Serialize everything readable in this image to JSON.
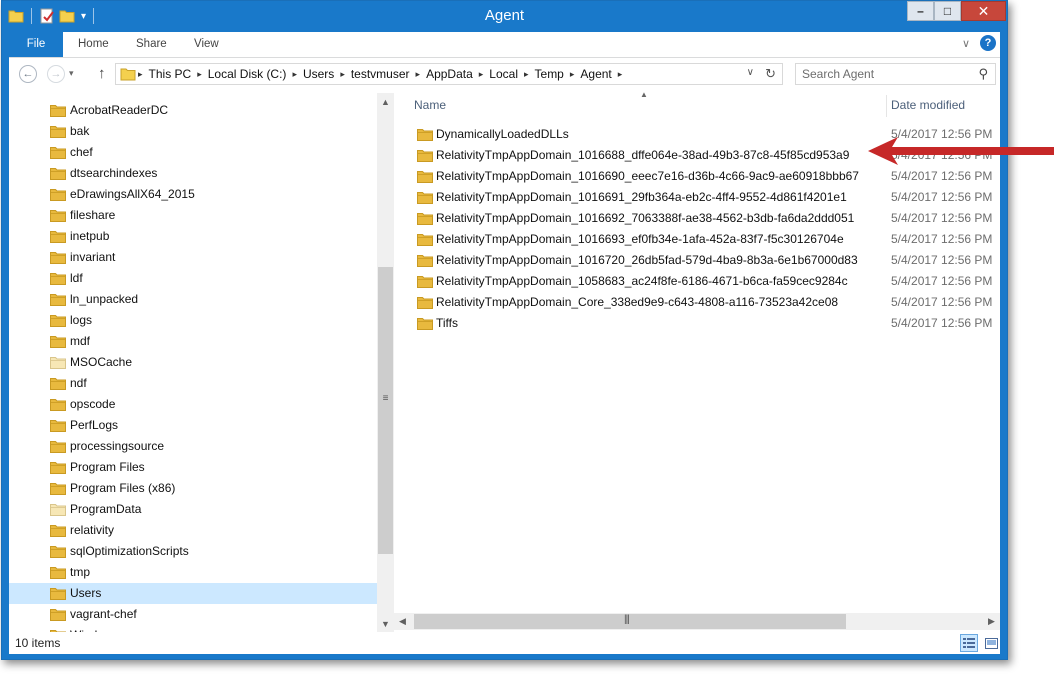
{
  "window": {
    "title": "Agent"
  },
  "ribbon": {
    "tabs": [
      "File",
      "Home",
      "Share",
      "View"
    ]
  },
  "address": {
    "crumbs": [
      "This PC",
      "Local Disk (C:)",
      "Users",
      "testvmuser",
      "AppData",
      "Local",
      "Temp",
      "Agent"
    ]
  },
  "search": {
    "placeholder": "Search Agent"
  },
  "columns": {
    "name": "Name",
    "date": "Date modified"
  },
  "tree": {
    "items": [
      "AcrobatReaderDC",
      "bak",
      "chef",
      "dtsearchindexes",
      "eDrawingsAllX64_2015",
      "fileshare",
      "inetpub",
      "invariant",
      "ldf",
      "ln_unpacked",
      "logs",
      "mdf",
      "MSOCache",
      "ndf",
      "opscode",
      "PerfLogs",
      "processingsource",
      "Program Files",
      "Program Files (x86)",
      "ProgramData",
      "relativity",
      "sqlOptimizationScripts",
      "tmp",
      "Users",
      "vagrant-chef",
      "Windows"
    ],
    "selected": "Users"
  },
  "files": [
    {
      "name": "DynamicallyLoadedDLLs",
      "date": "5/4/2017 12:56 PM"
    },
    {
      "name": "RelativityTmpAppDomain_1016688_dffe064e-38ad-49b3-87c8-45f85cd953a9",
      "date": "5/4/2017 12:56 PM"
    },
    {
      "name": "RelativityTmpAppDomain_1016690_eeec7e16-d36b-4c66-9ac9-ae60918bbb67",
      "date": "5/4/2017 12:56 PM"
    },
    {
      "name": "RelativityTmpAppDomain_1016691_29fb364a-eb2c-4ff4-9552-4d861f4201e1",
      "date": "5/4/2017 12:56 PM"
    },
    {
      "name": "RelativityTmpAppDomain_1016692_7063388f-ae38-4562-b3db-fa6da2ddd051",
      "date": "5/4/2017 12:56 PM"
    },
    {
      "name": "RelativityTmpAppDomain_1016693_ef0fb34e-1afa-452a-83f7-f5c30126704e",
      "date": "5/4/2017 12:56 PM"
    },
    {
      "name": "RelativityTmpAppDomain_1016720_26db5fad-579d-4ba9-8b3a-6e1b67000d83",
      "date": "5/4/2017 12:56 PM"
    },
    {
      "name": "RelativityTmpAppDomain_1058683_ac24f8fe-6186-4671-b6ca-fa59cec9284c",
      "date": "5/4/2017 12:56 PM"
    },
    {
      "name": "RelativityTmpAppDomain_Core_338ed9e9-c643-4808-a116-73523a42ce08",
      "date": "5/4/2017 12:56 PM"
    },
    {
      "name": "Tiffs",
      "date": "5/4/2017 12:56 PM"
    }
  ],
  "status": {
    "count": "10 items"
  },
  "colors": {
    "accent": "#1979ca",
    "selection": "#cce8ff",
    "folder": "#e8b93e",
    "annotation_arrow": "#c62828"
  },
  "icons": {
    "folder": "folder-icon",
    "back": "back-arrow-icon",
    "forward": "forward-arrow-icon",
    "up": "up-arrow-icon",
    "refresh": "refresh-icon",
    "search": "search-icon",
    "help": "help-icon",
    "annotation": "red-arrow-annotation"
  }
}
